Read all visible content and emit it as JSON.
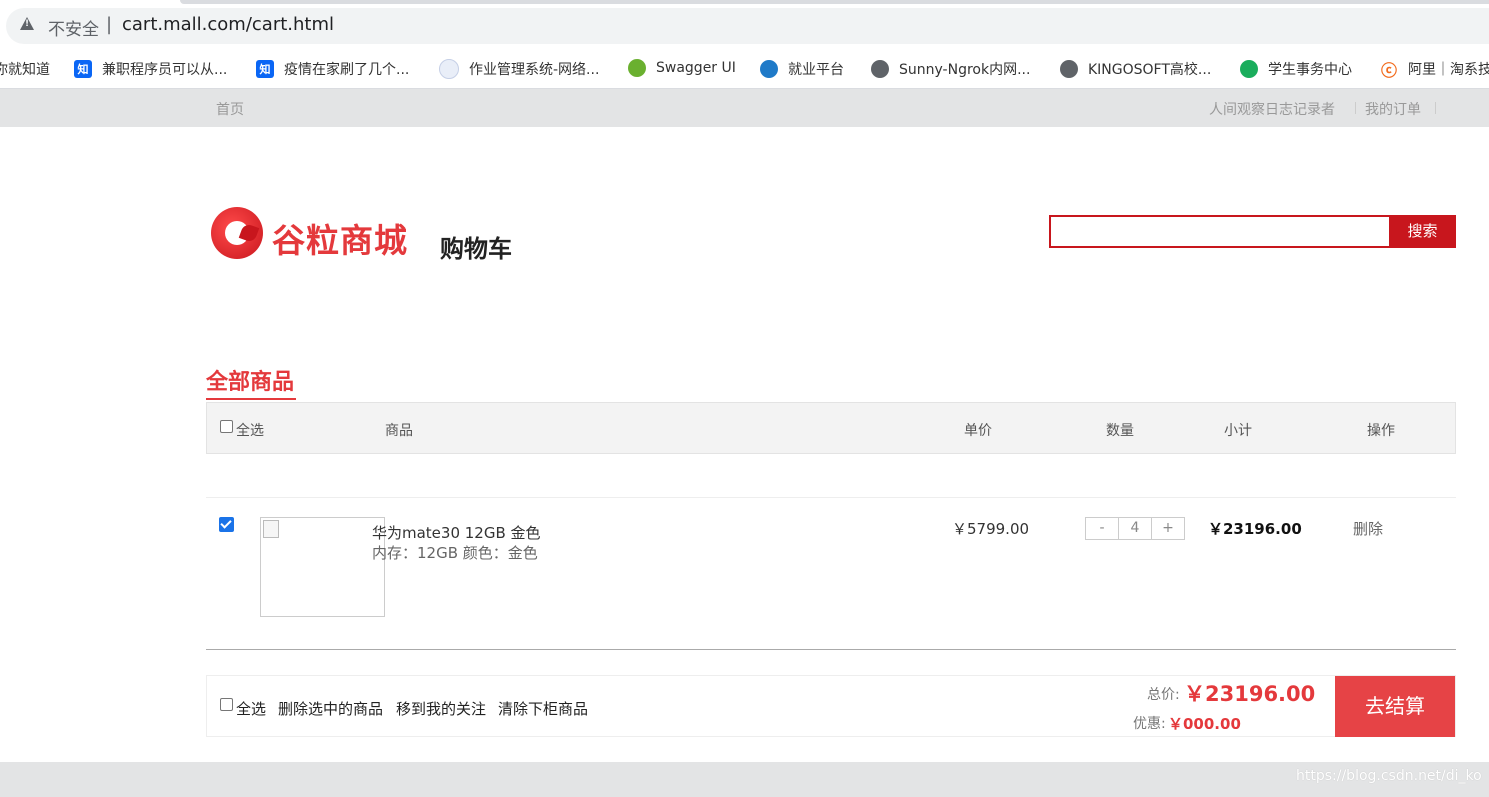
{
  "browser": {
    "security_label": "不安全",
    "separator": "|",
    "url": "cart.mall.com/cart.html",
    "bookmarks": [
      {
        "label": "你就知道",
        "icon": "none"
      },
      {
        "label": "兼职程序员可以从...",
        "icon": "zhihu-icon",
        "glyph": "知"
      },
      {
        "label": "疫情在家刷了几个...",
        "icon": "zhihu-icon",
        "glyph": "知"
      },
      {
        "label": "作业管理系统-网络...",
        "icon": "shield-icon"
      },
      {
        "label": "Swagger UI",
        "icon": "swagger-icon"
      },
      {
        "label": "就业平台",
        "icon": "graduation-icon"
      },
      {
        "label": "Sunny-Ngrok内网...",
        "icon": "globe-icon"
      },
      {
        "label": "KINGOSOFT高校...",
        "icon": "globe-icon"
      },
      {
        "label": "学生事务中心",
        "icon": "green-circle-icon"
      },
      {
        "label": "阿里｜淘系技",
        "icon": "ali-icon"
      }
    ]
  },
  "topbar": {
    "home": "首页",
    "user": "人间观察日志记录者",
    "orders": "我的订单"
  },
  "header": {
    "logo_text": "谷粒商城",
    "page_title": "购物车",
    "search_placeholder": "",
    "search_button": "搜索"
  },
  "cart": {
    "tab_label": "全部商品",
    "columns": {
      "select_all": "全选",
      "product": "商品",
      "unit_price": "单价",
      "quantity": "数量",
      "subtotal": "小计",
      "operation": "操作"
    },
    "items": [
      {
        "checked": true,
        "name": "华为mate30 12GB 金色",
        "attrs": "内存：12GB 颜色：金色",
        "price": "￥5799.00",
        "qty": "4",
        "qty_minus": "-",
        "qty_plus": "+",
        "subtotal": "￥23196.00",
        "delete": "删除"
      }
    ],
    "footer": {
      "select_all": "全选",
      "delete_selected": "删除选中的商品",
      "move_to_favorites": "移到我的关注",
      "clear_offshelf": "清除下柜商品",
      "total_label": "总价:",
      "total_value": "￥23196.00",
      "discount_label": "优惠:",
      "discount_value": "￥000.00",
      "checkout": "去结算"
    }
  },
  "watermark": "https://blog.csdn.net/di_ko",
  "colors": {
    "brand_red": "#e4393c",
    "search_red": "#c8161d",
    "checkout_red": "#e64346",
    "topbar_gray": "#e3e4e5"
  }
}
